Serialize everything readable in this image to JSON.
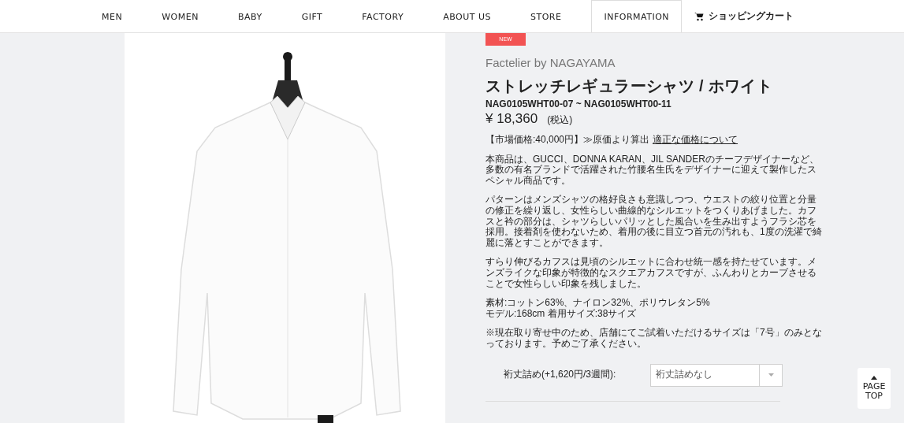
{
  "nav": [
    {
      "label": "MEN",
      "selected": false
    },
    {
      "label": "WOMEN",
      "selected": false
    },
    {
      "label": "BABY",
      "selected": false
    },
    {
      "label": "GIFT",
      "selected": false
    },
    {
      "label": "FACTORY",
      "selected": false
    },
    {
      "label": "ABOUT US",
      "selected": false
    },
    {
      "label": "STORE",
      "selected": false
    },
    {
      "label": "INFORMATION",
      "selected": true
    }
  ],
  "cart": {
    "label": "ショッピングカート"
  },
  "product": {
    "badge": "NEW",
    "brand": "Factelier by NAGAYAMA",
    "title": "ストレッチレギュラーシャツ / ホワイト",
    "code": "NAG0105WHT00-07 ~ NAG0105WHT00-11",
    "price": "¥ 18,360",
    "tax": "(税込)",
    "market_price": "【市場価格:40,000円】≫原価より算出",
    "market_link": "適正な価格について",
    "paragraphs": [
      "本商品は、GUCCI、DONNA KARAN、JIL SANDERのチーフデザイナーなど、多数の有名ブランドで活躍された竹腰名生氏をデザイナーに迎えて製作したスペシャル商品です。",
      "パターンはメンズシャツの格好良さも意識しつつ、ウエストの絞り位置と分量の修正を繰り返し、女性らしい曲線的なシルエットをつくりあげました。カフスと衿の部分は、シャツらしいパリッとした風合いを生み出すようフラシ芯を採用。接着剤を使わないため、着用の後に目立つ首元の汚れも、1度の洗濯で綺麗に落とすことができます。",
      "すらり伸びるカフスは見頃のシルエットに合わせ統一感を持たせています。メンズライクな印象が特徴的なスクエアカフスですが、ふんわりとカーブさせることで女性らしい印象を残しました。"
    ],
    "specs": [
      "素材:コットン63%、ナイロン32%、ポリウレタン5%",
      "モデル:168cm 着用サイズ:38サイズ"
    ],
    "note": "※現在取り寄せ中のため、店舗にてご試着いただけるサイズは「7号」のみとなっております。予めご了承ください。",
    "option": {
      "label": "裄丈詰め(+1,620円/3週間):",
      "value": "裄丈詰めなし"
    }
  },
  "page_top": {
    "label": "PAGE TOP"
  }
}
